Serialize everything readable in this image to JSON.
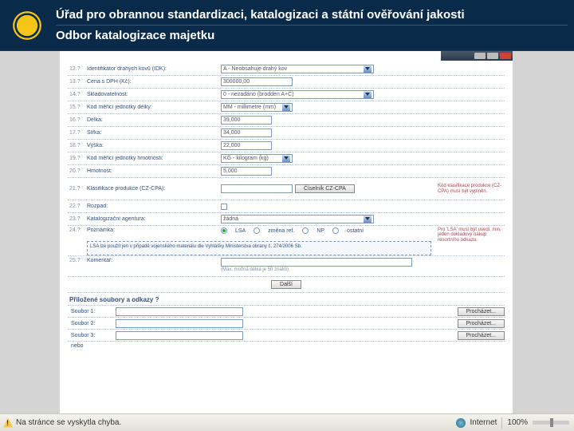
{
  "header": {
    "title_line1": "Úřad pro obrannou standardizaci, katalogizaci a státní ověřování jakosti",
    "title_line2": "Odbor katalogizace majetku"
  },
  "form": {
    "r12": {
      "num": "12.?",
      "label": "Identifikátor drahých kovů (IDK):",
      "value": "A - Neobsahuje drahý kov"
    },
    "r13": {
      "num": "13.?",
      "label": "Cena s DPH (Kč):",
      "value": "300000,00"
    },
    "r14": {
      "num": "14.?",
      "label": "Skladovatelnost:",
      "value": "0 - nezadáno (brodden A+C)"
    },
    "r15": {
      "num": "15.?",
      "label": "Kód měřicí jednotky délky:",
      "value": "MM - millimetre (mm)"
    },
    "r16": {
      "num": "16.?",
      "label": "Délka:",
      "value": "39,000"
    },
    "r17": {
      "num": "17.?",
      "label": "Šířka:",
      "value": "34,000"
    },
    "r18": {
      "num": "18.?",
      "label": "Výška:",
      "value": "22,000"
    },
    "r19": {
      "num": "19.?",
      "label": "Kód měřicí jednotky hmotnosti:",
      "value": "KG - kilogram (kg)"
    },
    "r20": {
      "num": "20.?",
      "label": "Hmotnost:",
      "value": "5,000"
    },
    "r21": {
      "num": "21.?",
      "label": "Klasifikace produkce (CZ-CPA):",
      "value": "",
      "btn": "Číselník CZ-CPA",
      "note": "Kód klasifikace produkce (CZ-CPA) musí být vyplněn."
    },
    "r22": {
      "num": "22.?",
      "label": "Rozpad:",
      "cb": false
    },
    "r23": {
      "num": "23.?",
      "label": "Katalogizační agentura:",
      "value": "žádná"
    },
    "r24": {
      "num": "24.?",
      "label": "Poznámka:",
      "opts": {
        "lsa": "LSA",
        "zmena": "změna ref.",
        "np": "NP",
        "ostatni": "ostatní"
      },
      "note_side": "Pro 'LSA' musí být uvedl. min. jeden dokladový nákup resortního odkazu.",
      "textbox": "LSA lze použít jen v případě vojenského materiálu dle Vyhlášky Ministerstva obrany č. 274/2006 Sb."
    },
    "r25": {
      "num": "25.?",
      "label": "Komentář:",
      "value": "",
      "hint": "(Max. možná délka je 50 znaků)"
    },
    "submit": "Další",
    "files": {
      "title": "Přiložené soubory a odkazy ?",
      "f1": "Soubor 1:",
      "f2": "Soubor 2:",
      "f3": "Soubor 3:",
      "browse": "Procházet...",
      "nebo": "nebo"
    }
  },
  "status": {
    "left": "Na stránce se vyskytla chyba.",
    "internet": "Internet",
    "zoom": "100%"
  }
}
